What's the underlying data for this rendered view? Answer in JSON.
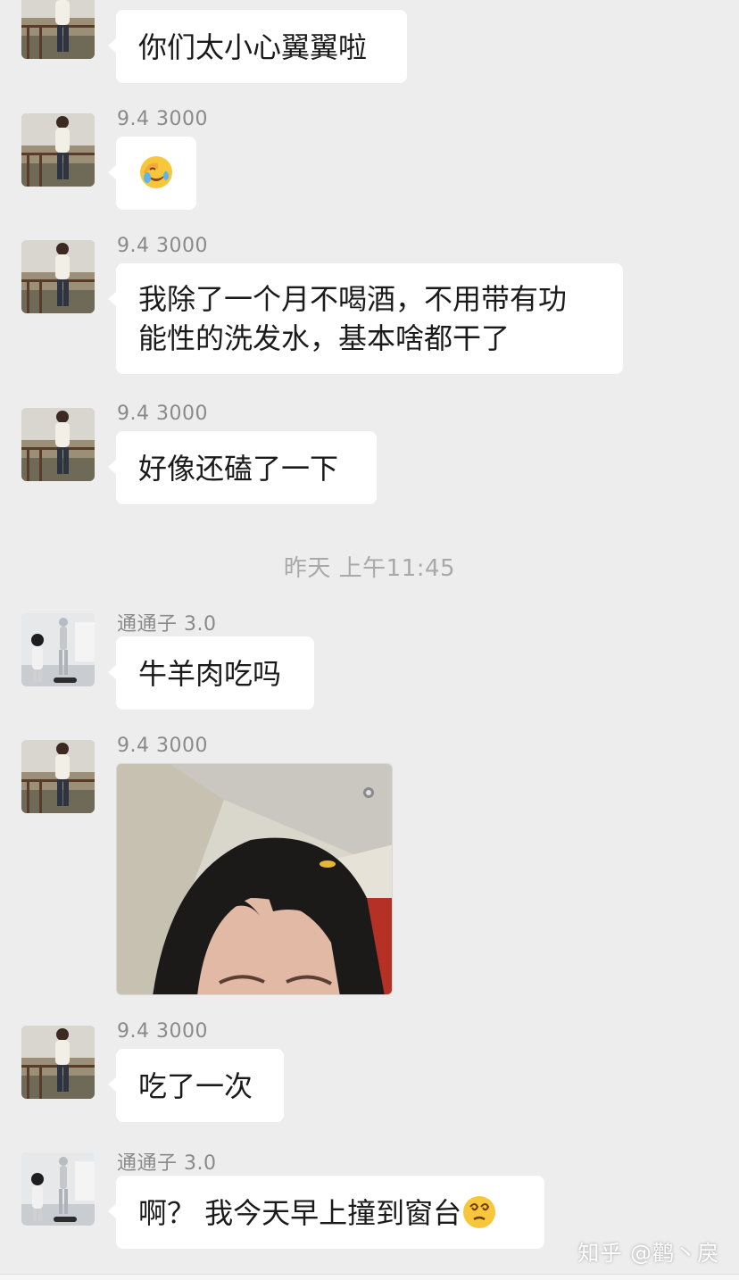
{
  "contacts": {
    "a": "9.4   3000",
    "b": "通通子 3.0"
  },
  "messages": [
    {
      "id": "m1",
      "text": "你们太小心翼翼啦"
    },
    {
      "id": "m2",
      "emoji": "facepalm-cry-emoji"
    },
    {
      "id": "m3",
      "line1": "我除了一个月不喝酒，不用带有功",
      "line2": "能性的洗发水，基本啥都干了"
    },
    {
      "id": "m4",
      "text": "好像还磕了一下"
    },
    {
      "id": "m5",
      "text": "牛羊肉吃吗"
    },
    {
      "id": "m6",
      "image": "forehead-selfie-photo"
    },
    {
      "id": "m7",
      "text": "吃了一次"
    },
    {
      "id": "m8",
      "text": "啊？ 我今天早上撞到窗台",
      "emoji": "dizzy-face-emoji"
    }
  ],
  "timestamp": "昨天 上午11:45",
  "watermark": "知乎 @鹳丶戾",
  "colors": {
    "background": "#ededed",
    "bubble": "#ffffff",
    "meta_text": "#8a8a8a",
    "timestamp_text": "#a9a9a9"
  }
}
